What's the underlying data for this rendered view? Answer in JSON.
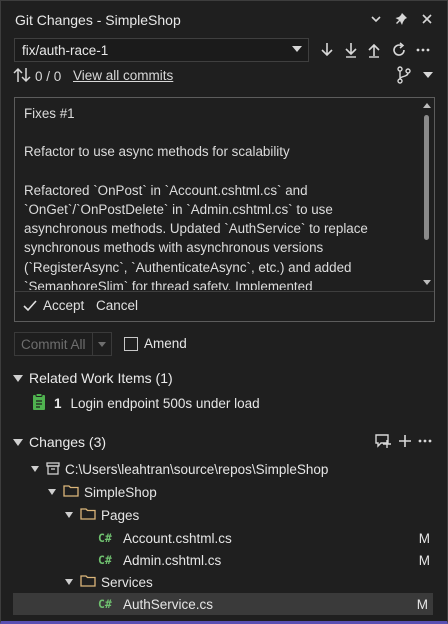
{
  "window": {
    "title": "Git Changes - SimpleShop"
  },
  "branch": {
    "selected": "fix/auth-race-1"
  },
  "sync": {
    "counts": "0 / 0",
    "view_all_label": "View all commits"
  },
  "commit_message": {
    "paragraphs": [
      "Fixes #1",
      "Refactor to use async methods for scalability",
      "Refactored `OnPost` in `Account.cshtml.cs` and `OnGet`/`OnPostDelete` in `Admin.cshtml.cs` to use asynchronous methods. Updated `AuthService` to replace synchronous methods with asynchronous versions (`RegisterAsync`, `AuthenticateAsync`, etc.) and added `SemaphoreSlim` for thread safety. Implemented `IAsyncDisposable` in `AuthService` to ensure proper disposal of"
    ],
    "accept_label": "Accept",
    "cancel_label": "Cancel"
  },
  "commit": {
    "commit_all_label": "Commit All",
    "amend_label": "Amend"
  },
  "related_work_items": {
    "header": "Related Work Items (1)",
    "items": [
      {
        "id": "1",
        "title": "Login endpoint 500s under load"
      }
    ]
  },
  "changes": {
    "header": "Changes (3)",
    "repo_path": "C:\\Users\\leahtran\\source\\repos\\SimpleShop",
    "project": "SimpleShop",
    "folders": [
      {
        "name": "Pages",
        "files": [
          {
            "name": "Account.cshtml.cs",
            "status": "M",
            "icon_label": "C#"
          },
          {
            "name": "Admin.cshtml.cs",
            "status": "M",
            "icon_label": "C#"
          }
        ]
      },
      {
        "name": "Services",
        "files": [
          {
            "name": "AuthService.cs",
            "status": "M",
            "icon_label": "C#"
          }
        ]
      }
    ]
  },
  "colors": {
    "accent": "#5a4fb2",
    "csharp": "#6fc06f",
    "work_item": "#4fb24f",
    "folder": "#dcb67a"
  },
  "icons": [
    "chevron-down-icon",
    "pin-icon",
    "close-icon",
    "fetch-icon",
    "pull-icon",
    "push-icon",
    "sync-icon",
    "more-icon",
    "incoming-outgoing-icon",
    "branch-icon",
    "check-icon",
    "work-item-icon",
    "repo-icon",
    "folder-icon",
    "csharp-file-icon",
    "stash-icon",
    "add-icon"
  ]
}
